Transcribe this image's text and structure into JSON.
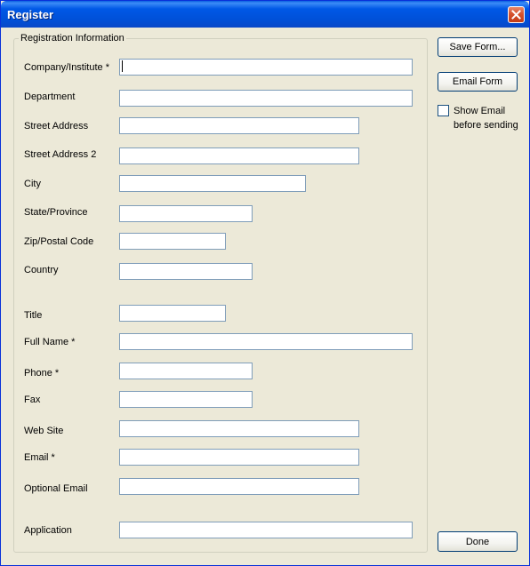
{
  "window": {
    "title": "Register"
  },
  "group": {
    "title": "Registration Information"
  },
  "fields": [
    {
      "label": "Company/Institute *",
      "value": ""
    },
    {
      "label": "Department",
      "value": ""
    },
    {
      "label": "Street Address",
      "value": ""
    },
    {
      "label": "Street Address 2",
      "value": ""
    },
    {
      "label": "City",
      "value": ""
    },
    {
      "label": "State/Province",
      "value": ""
    },
    {
      "label": "Zip/Postal Code",
      "value": ""
    },
    {
      "label": "Country",
      "value": ""
    },
    {
      "label": "Title",
      "value": ""
    },
    {
      "label": "Full Name *",
      "value": ""
    },
    {
      "label": "Phone *",
      "value": ""
    },
    {
      "label": "Fax",
      "value": ""
    },
    {
      "label": "Web Site",
      "value": ""
    },
    {
      "label": "Email *",
      "value": ""
    },
    {
      "label": "Optional Email",
      "value": ""
    },
    {
      "label": "Application",
      "value": ""
    }
  ],
  "actions": {
    "save_label": "Save Form...",
    "email_label": "Email Form",
    "done_label": "Done"
  },
  "show_email": {
    "label_line1": "Show Email",
    "label_line2": "before sending",
    "checked": false
  },
  "icons": {
    "close": "close-icon"
  },
  "colors": {
    "titlebar": "#0058e6",
    "face": "#ece9d8",
    "close": "#d5532f"
  }
}
